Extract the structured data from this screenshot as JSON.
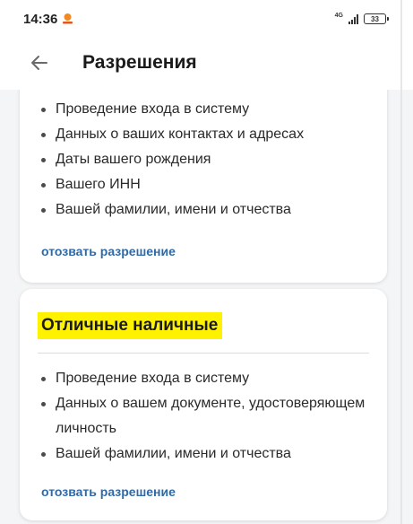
{
  "status_bar": {
    "time": "14:36",
    "network": "4G",
    "battery": "33"
  },
  "header": {
    "title": "Разрешения",
    "back_icon": "arrow-left-icon"
  },
  "cards": [
    {
      "items": [
        "Проведение входа в систему",
        "Данных о ваших контактах и адресах",
        "Даты вашего рождения",
        "Вашего ИНН",
        "Вашей фамилии, имени и отчества"
      ],
      "revoke_label": "отозвать разрешение"
    },
    {
      "title": "Отличные наличные",
      "items": [
        "Проведение входа в систему",
        "Данных о вашем документе, удостоверяющем личность",
        "Вашей фамилии, имени и отчества"
      ],
      "revoke_label": "отозвать разрешение"
    }
  ],
  "colors": {
    "link": "#2f6aa8",
    "highlight": "#fff200",
    "background": "#f4f5f7"
  }
}
